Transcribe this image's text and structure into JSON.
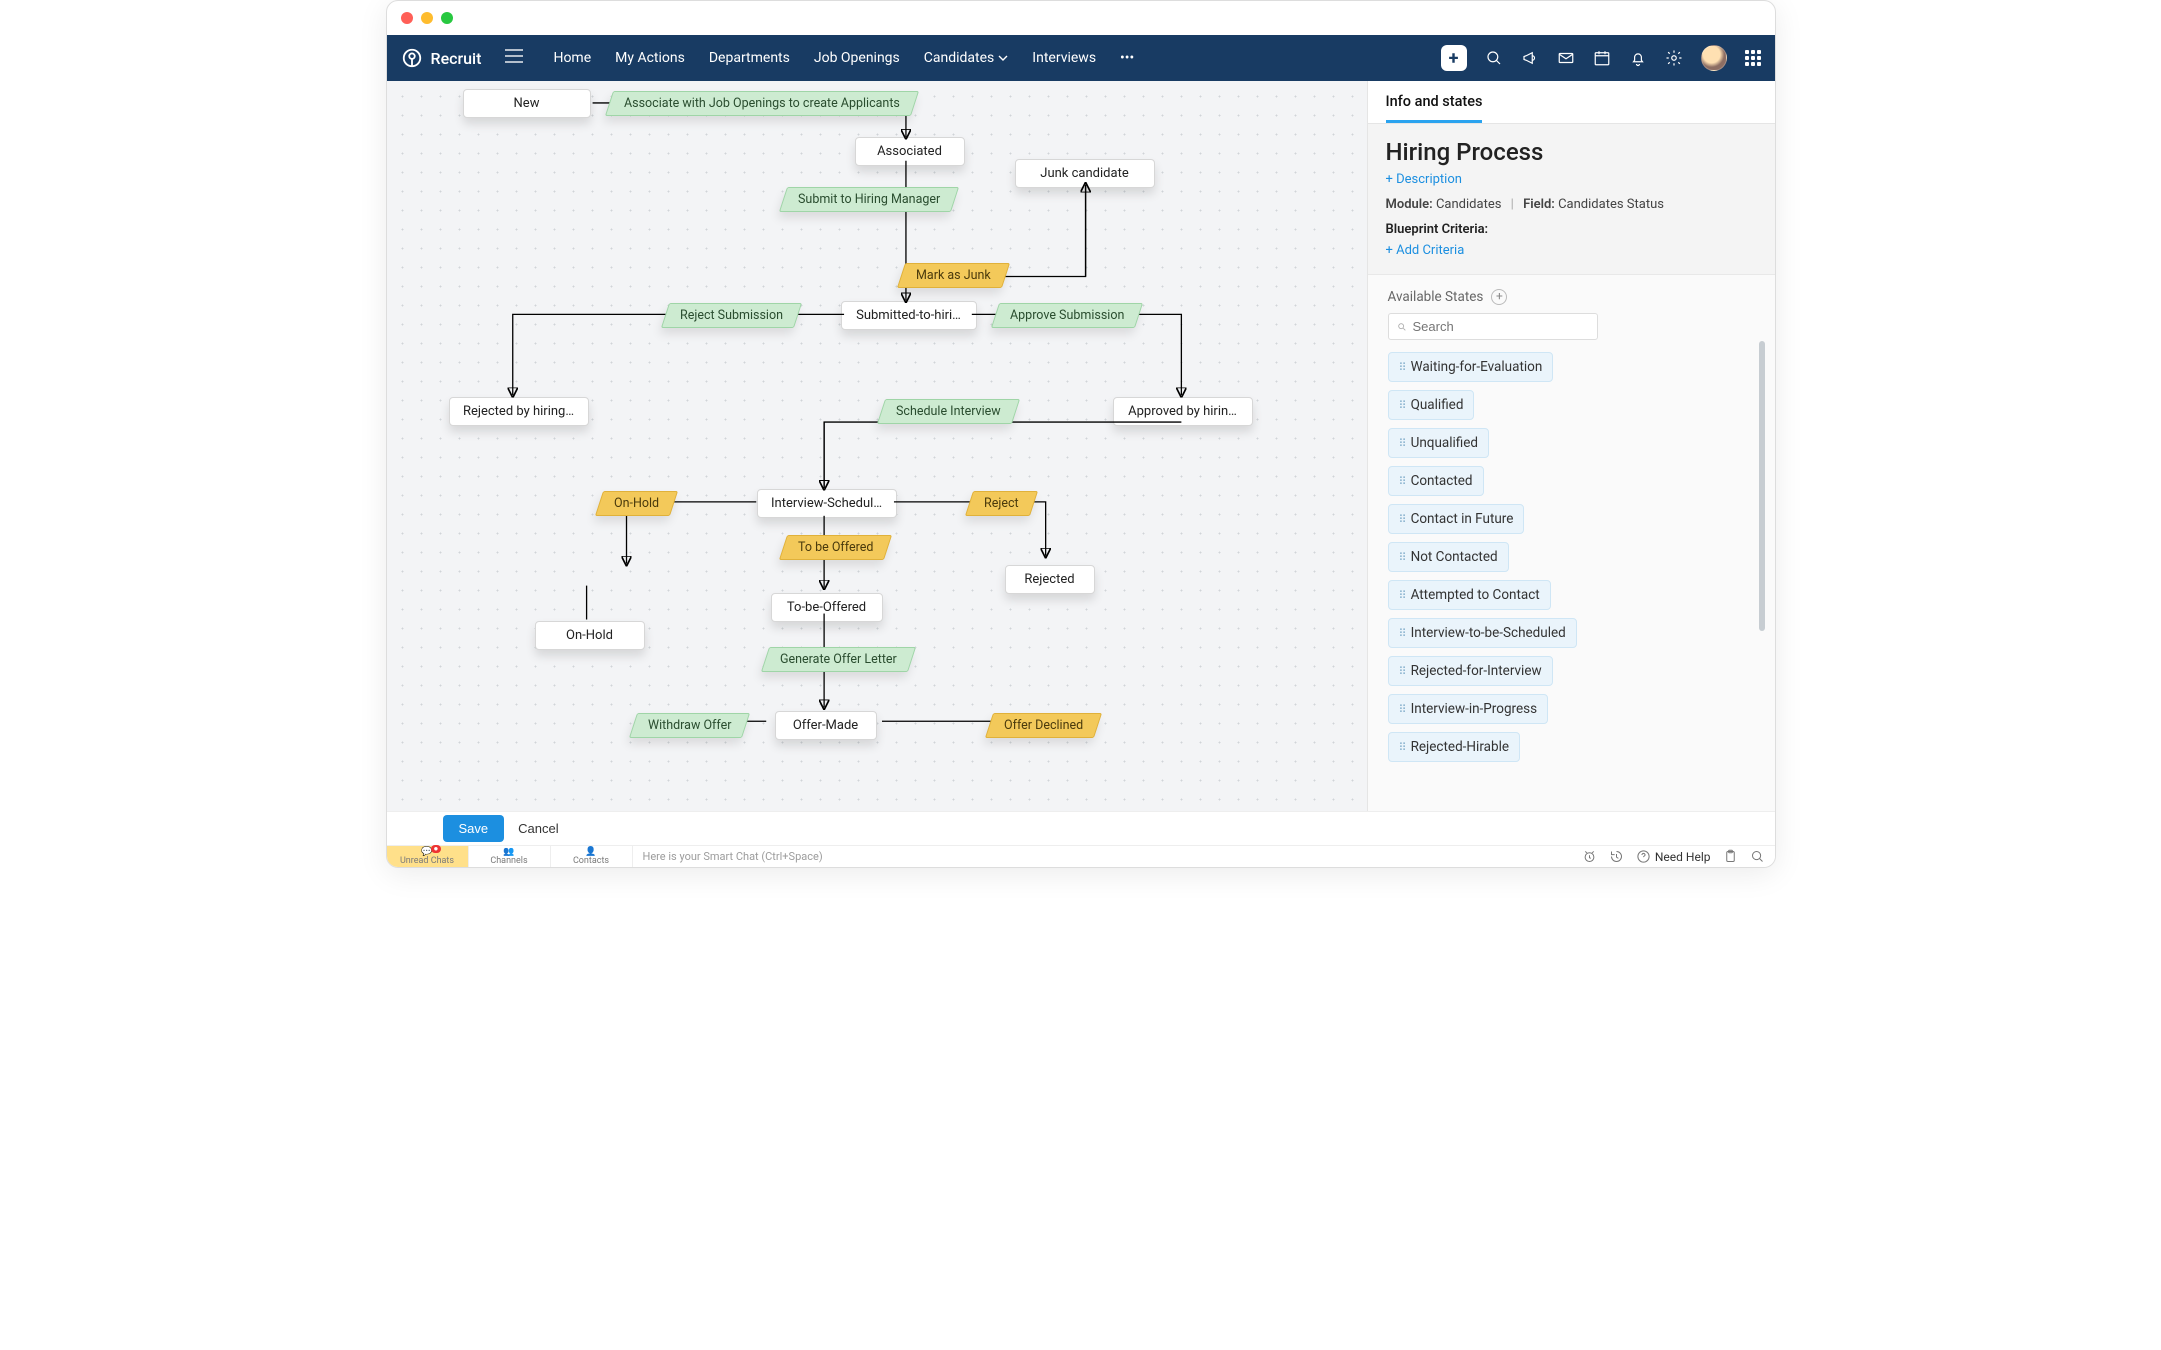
{
  "brand": "Recruit",
  "nav": {
    "items": [
      "Home",
      "My Actions",
      "Departments",
      "Job Openings",
      "Candidates",
      "Interviews"
    ]
  },
  "canvas": {
    "states": {
      "new": "New",
      "associated": "Associated",
      "junk": "Junk candidate",
      "submitted": "Submitted-to-hiri…",
      "rejected_hm": "Rejected by hiring…",
      "approved_hm": "Approved by hirin…",
      "interview_sched": "Interview-Schedul…",
      "onhold": "On-Hold",
      "rejected": "Rejected",
      "to_be_offered": "To-be-Offered",
      "offer_made": "Offer-Made"
    },
    "transitions": {
      "associate": "Associate with Job Openings to create Applicants",
      "submit_hm": "Submit to Hiring Manager",
      "mark_junk": "Mark as Junk",
      "reject_sub": "Reject Submission",
      "approve_sub": "Approve Submission",
      "schedule_int": "Schedule Interview",
      "onhold_t": "On-Hold",
      "reject_t": "Reject",
      "to_be_offered_t": "To be Offered",
      "gen_offer": "Generate Offer Letter",
      "withdraw": "Withdraw Offer",
      "declined": "Offer Declined"
    }
  },
  "side": {
    "tab": "Info and states",
    "title": "Hiring Process",
    "desc_link": "+ Description",
    "module_label": "Module:",
    "module_value": "Candidates",
    "field_label": "Field:",
    "field_value": "Candidates Status",
    "criteria_label": "Blueprint Criteria:",
    "add_criteria": "+ Add Criteria",
    "available_label": "Available States",
    "search_placeholder": "Search",
    "states": [
      "Waiting-for-Evaluation",
      "Qualified",
      "Unqualified",
      "Contacted",
      "Contact in Future",
      "Not Contacted",
      "Attempted to Contact",
      "Interview-to-be-Scheduled",
      "Rejected-for-Interview",
      "Interview-in-Progress",
      "Rejected-Hirable"
    ]
  },
  "footer": {
    "save": "Save",
    "cancel": "Cancel"
  },
  "bottombar": {
    "tabs": [
      "Unread Chats",
      "Channels",
      "Contacts"
    ],
    "smart_chat": "Here is your Smart Chat (Ctrl+Space)",
    "need_help": "Need Help"
  }
}
